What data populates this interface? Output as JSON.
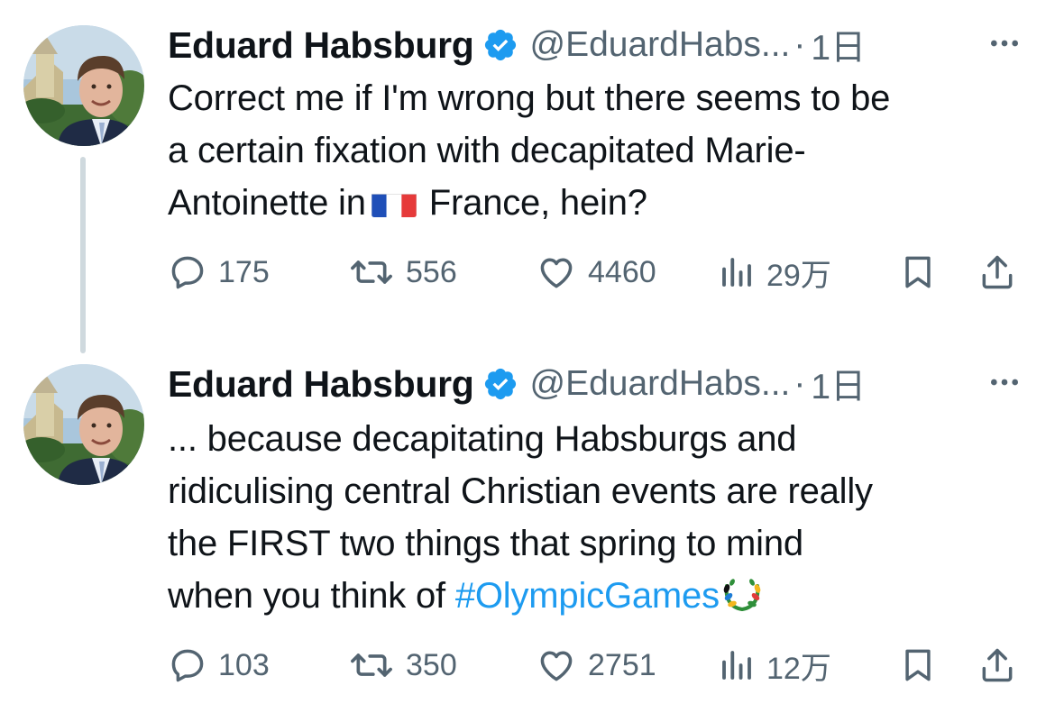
{
  "colors": {
    "text": "#0f1419",
    "secondary": "#536471",
    "accent": "#1d9bf0",
    "thread_line": "#cfd9de"
  },
  "tweets": [
    {
      "author": {
        "name": "Eduard Habsburg",
        "handle": "@EduardHabs...",
        "verified_icon": "verified-badge-icon"
      },
      "separator": "·",
      "time": "1日",
      "text_lines": [
        "Correct me if I'm wrong but there seems to be",
        "a certain fixation with decapitated Marie-",
        "Antoinette in",
        "France, hein?"
      ],
      "inline_emoji": "french-flag-icon",
      "stats": {
        "replies": "175",
        "retweets": "556",
        "likes": "4460",
        "views": "29万"
      }
    },
    {
      "author": {
        "name": "Eduard Habsburg",
        "handle": "@EduardHabs...",
        "verified_icon": "verified-badge-icon"
      },
      "separator": "·",
      "time": "1日",
      "text_lines": [
        "... because decapitating Habsburgs and",
        "ridiculising central Christian events are really",
        "the FIRST two things that spring to mind",
        "when you think of"
      ],
      "hashtag": "#OlympicGames",
      "inline_emoji": "olympic-wreath-icon",
      "stats": {
        "replies": "103",
        "retweets": "350",
        "likes": "2751",
        "views": "12万"
      }
    }
  ]
}
